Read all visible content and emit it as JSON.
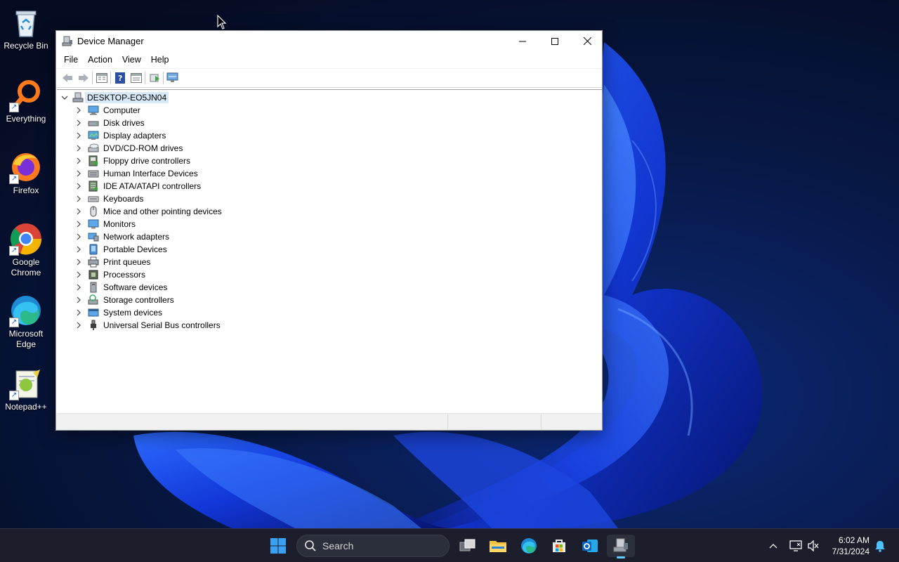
{
  "desktop": {
    "icons": [
      {
        "label": "Recycle Bin",
        "icon": "recycle-bin-icon"
      },
      {
        "label": "Everything",
        "icon": "everything-search-icon"
      },
      {
        "label": "Firefox",
        "icon": "firefox-icon"
      },
      {
        "label": "Google Chrome",
        "icon": "chrome-icon"
      },
      {
        "label": "Microsoft Edge",
        "icon": "edge-icon"
      },
      {
        "label": "Notepad++",
        "icon": "notepadpp-icon"
      }
    ]
  },
  "window": {
    "title": "Device Manager",
    "menu": [
      "File",
      "Action",
      "View",
      "Help"
    ],
    "tree": {
      "root": "DESKTOP-EO5JN04",
      "categories": [
        "Computer",
        "Disk drives",
        "Display adapters",
        "DVD/CD-ROM drives",
        "Floppy drive controllers",
        "Human Interface Devices",
        "IDE ATA/ATAPI controllers",
        "Keyboards",
        "Mice and other pointing devices",
        "Monitors",
        "Network adapters",
        "Portable Devices",
        "Print queues",
        "Processors",
        "Software devices",
        "Storage controllers",
        "System devices",
        "Universal Serial Bus controllers"
      ]
    }
  },
  "taskbar": {
    "search_label": "Search",
    "time": "6:02 AM",
    "date": "7/31/2024"
  },
  "colors": {
    "accent": "#0067c0",
    "wallpaper_dark": "#07112a",
    "wallpaper_blue": "#1a4dff",
    "taskbar": "#1c1f2b"
  }
}
